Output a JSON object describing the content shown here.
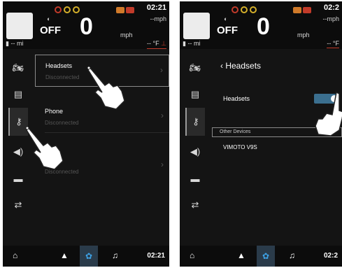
{
  "status_bar": {
    "time": "02:21",
    "time_right_cut": "02:2",
    "speed_unit_top": "--mph",
    "speed_unit_top_cut": "--mph",
    "cruise_label": "OFF",
    "speed": "0",
    "speed_unit": "mph",
    "fuel": "-- mi",
    "temp_value": "-- °F",
    "temp_value_cut": "-- °F",
    "warning_colors": [
      "#c23b2a",
      "#d5b02a",
      "#d5b02a"
    ],
    "engine_colors": [
      "#d07a2a",
      "#c23b2a"
    ]
  },
  "sidebar_icons": [
    "motorcycle-icon",
    "display-icon",
    "bluetooth-icon",
    "audio-icon",
    "screen-icon",
    "settings-sliders-icon"
  ],
  "screen1": {
    "items": [
      {
        "title": "Headsets",
        "sub": "Disconnected"
      },
      {
        "title": "Phone",
        "sub": "Disconnected"
      },
      {
        "title": "",
        "sub": "Disconnected"
      }
    ]
  },
  "screen2": {
    "header": "Headsets",
    "back_glyph": "‹",
    "toggle_label": "Headsets",
    "toggle_state": "on",
    "section": "Other Devices",
    "devices": [
      "VIMOTO V9S"
    ]
  },
  "bottom_nav": {
    "items": [
      "home-icon",
      "navigation-icon",
      "settings-gear-icon",
      "music-icon"
    ],
    "time": "02:21",
    "time_cut": "02:2"
  },
  "colors": {
    "accent": "#3ea2e6",
    "toggle": "#3b6f8f",
    "warning_red": "#c23b2a"
  }
}
